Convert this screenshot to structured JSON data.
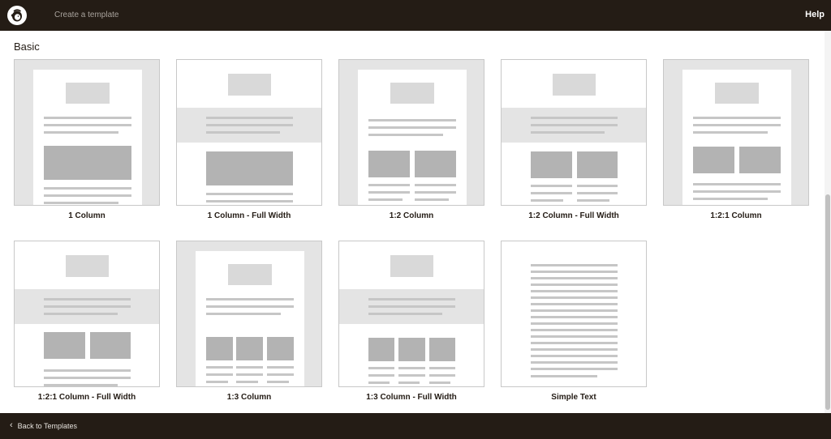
{
  "header": {
    "title": "Create a template",
    "help_label": "Help",
    "logo_icon": "freddie-logo-icon"
  },
  "section": {
    "title": "Basic"
  },
  "templates": [
    {
      "label": "1 Column"
    },
    {
      "label": "1 Column - Full Width"
    },
    {
      "label": "1:2 Column"
    },
    {
      "label": "1:2 Column - Full Width"
    },
    {
      "label": "1:2:1 Column"
    },
    {
      "label": "1:2:1 Column - Full Width"
    },
    {
      "label": "1:3 Column"
    },
    {
      "label": "1:3 Column - Full Width"
    },
    {
      "label": "Simple Text"
    }
  ],
  "footer": {
    "back_label": "Back to Templates",
    "back_icon": "chevron-left-icon"
  },
  "colors": {
    "bar": "#241c15",
    "thumb_grey": "#e4e4e4",
    "block": "#b3b3b3"
  }
}
